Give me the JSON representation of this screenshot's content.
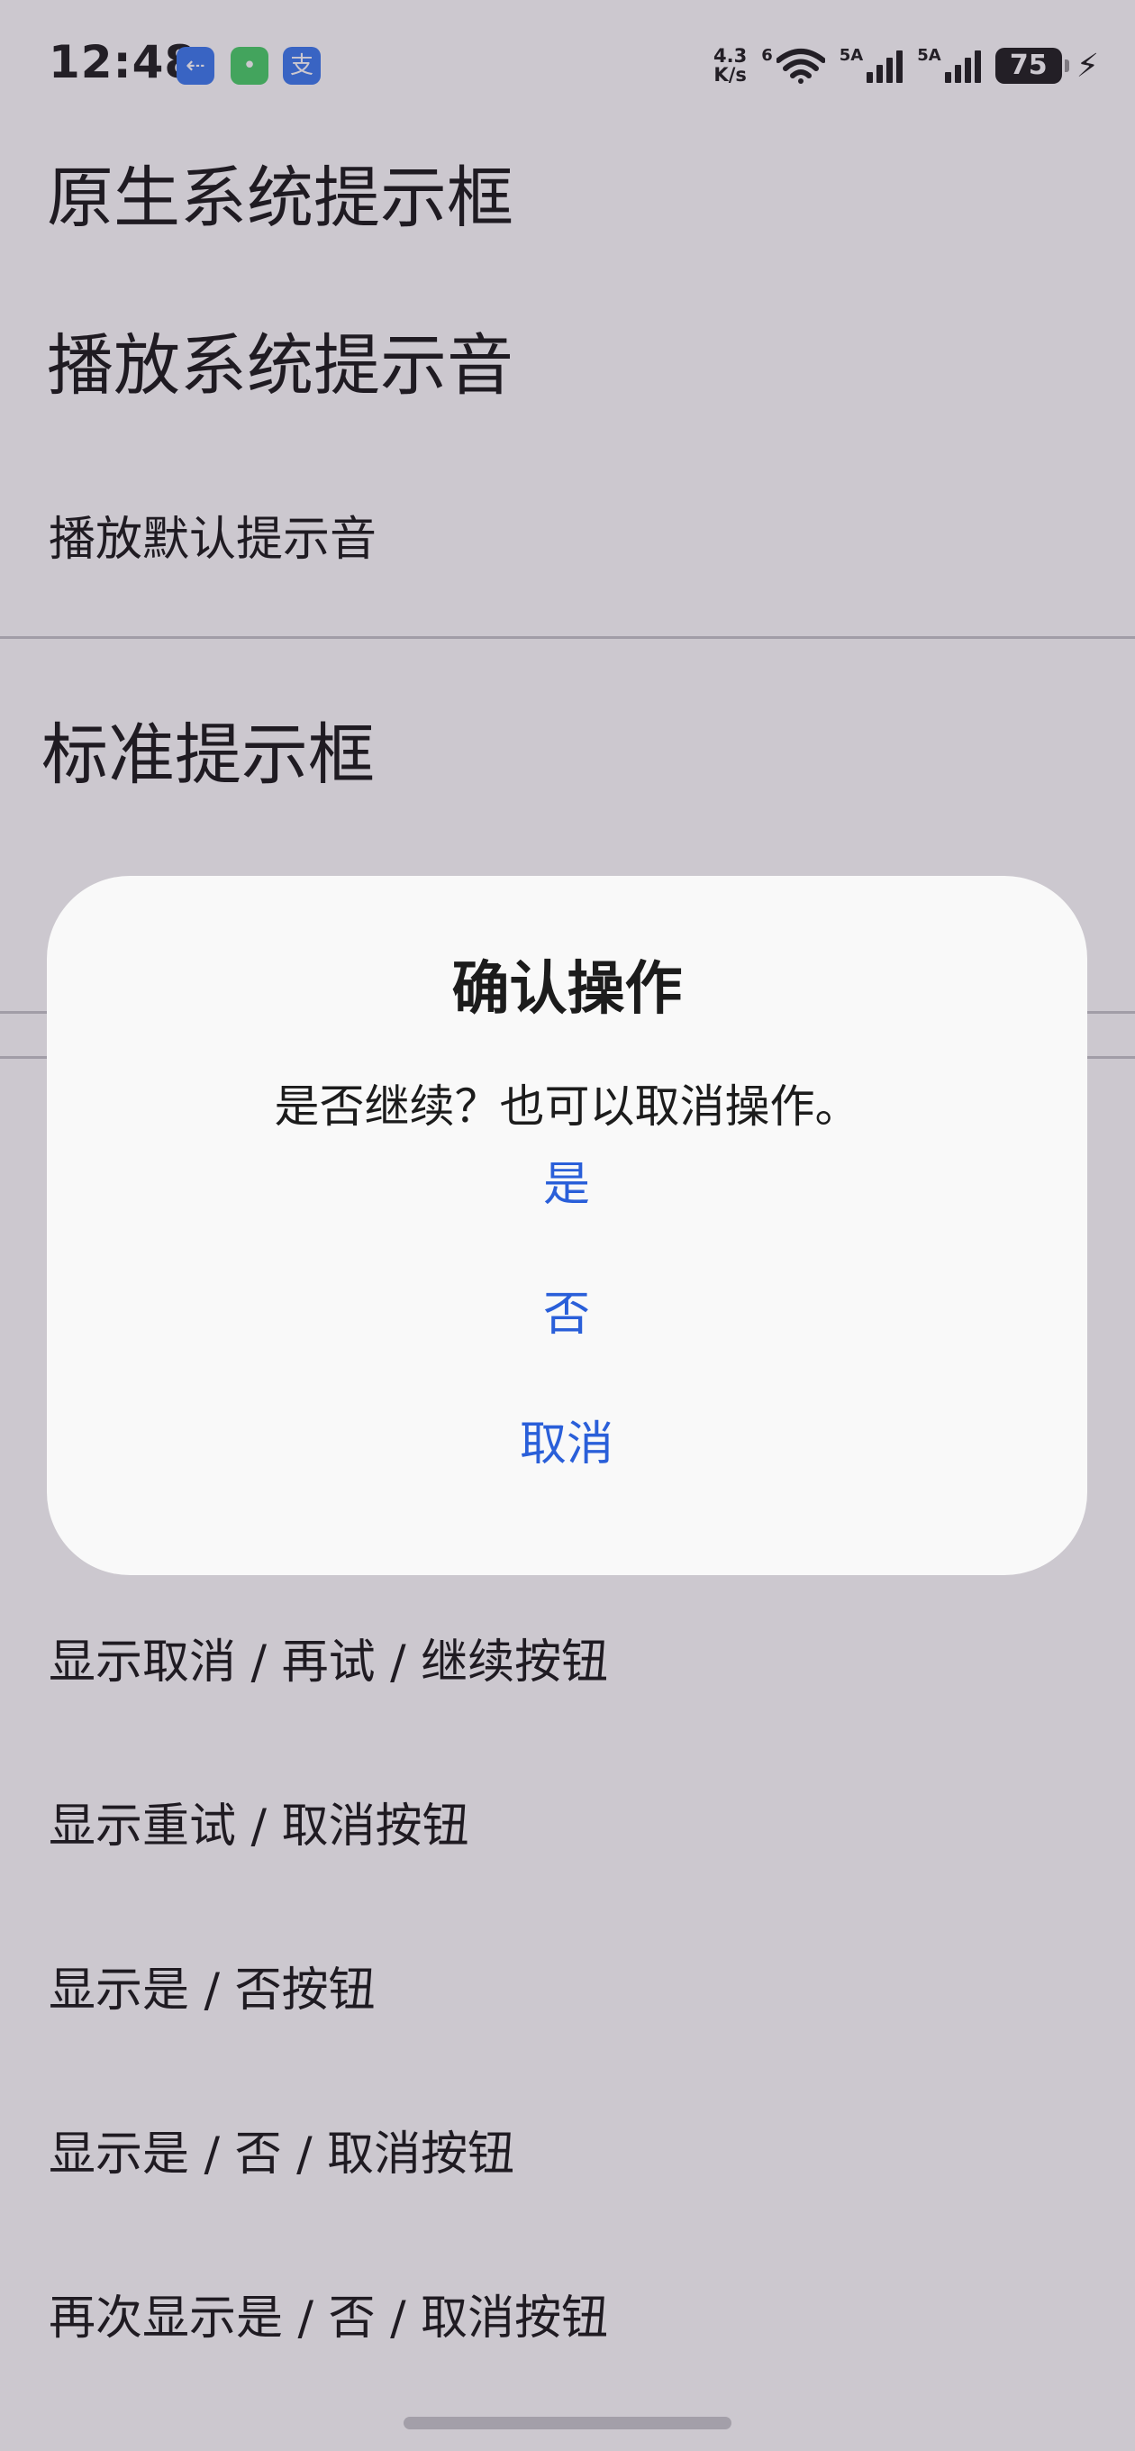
{
  "status_bar": {
    "time": "12:48",
    "badges": {
      "usb": "⇠",
      "chat": "•",
      "pay": "支"
    },
    "net_speed_value": "4.3",
    "net_speed_unit": "K/s",
    "wifi_label": "6",
    "sim1_label": "5A",
    "sim2_label": "5A",
    "battery": "75"
  },
  "page": {
    "section_native": "原生系统提示框",
    "section_sound": "播放系统提示音",
    "item_play_default": "播放默认提示音",
    "section_standard": "标准提示框",
    "items": [
      "显示取消 / 再试 / 继续按钮",
      "显示重试 / 取消按钮",
      "显示是 / 否按钮",
      "显示是 / 否 / 取消按钮",
      "再次显示是 / 否 / 取消按钮"
    ]
  },
  "dialog": {
    "title": "确认操作",
    "message": "是否继续？也可以取消操作。",
    "yes_label": "是",
    "no_label": "否",
    "cancel_label": "取消"
  },
  "colors": {
    "accent": "#2a5fd9",
    "scrim": "#cbc6cd",
    "dialog_bg": "#f9f9f9"
  }
}
